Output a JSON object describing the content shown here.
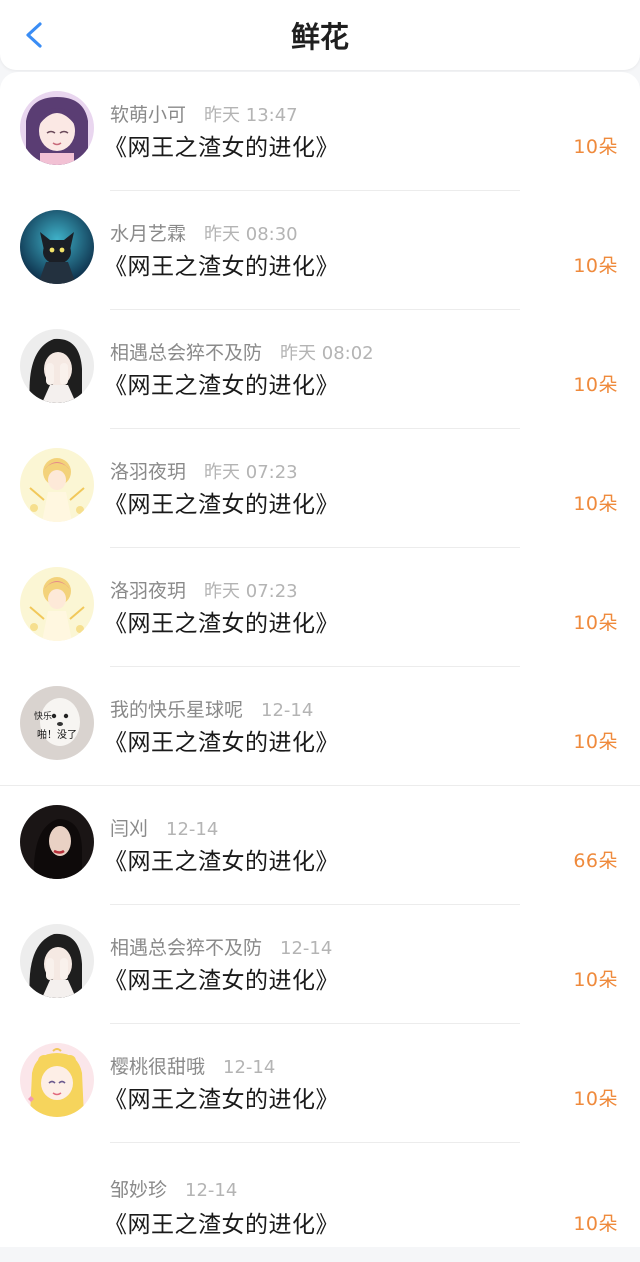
{
  "header": {
    "title": "鲜花",
    "back_icon": "chevron-left-icon",
    "accent": "#3a8df5"
  },
  "colors": {
    "count": "#ef8a3c"
  },
  "items": [
    {
      "user": "软萌小可",
      "time": "昨天 13:47",
      "book": "《网王之渣女的进化》",
      "count": "10朵",
      "avatar": "anime-girl-purple-avatar"
    },
    {
      "user": "水月艺霖",
      "time": "昨天 08:30",
      "book": "《网王之渣女的进化》",
      "count": "10朵",
      "avatar": "dark-knight-avatar"
    },
    {
      "user": "相遇总会猝不及防",
      "time": "昨天 08:02",
      "book": "《网王之渣女的进化》",
      "count": "10朵",
      "avatar": "girl-covering-face-avatar"
    },
    {
      "user": "洛羽夜玥",
      "time": "昨天 07:23",
      "book": "《网王之渣女的进化》",
      "count": "10朵",
      "avatar": "cardcaptor-avatar"
    },
    {
      "user": "洛羽夜玥",
      "time": "昨天 07:23",
      "book": "《网王之渣女的进化》",
      "count": "10朵",
      "avatar": "cardcaptor-avatar"
    },
    {
      "user": "我的快乐星球呢",
      "time": "12-14",
      "book": "《网王之渣女的进化》",
      "count": "10朵",
      "avatar": "white-dog-meme-avatar",
      "avatar_text": [
        "快乐",
        "啪！没了"
      ]
    },
    {
      "user": "闫刈",
      "time": "12-14",
      "book": "《网王之渣女的进化》",
      "count": "66朵",
      "avatar": "dark-portrait-avatar"
    },
    {
      "user": "相遇总会猝不及防",
      "time": "12-14",
      "book": "《网王之渣女的进化》",
      "count": "10朵",
      "avatar": "girl-covering-face-avatar"
    },
    {
      "user": "樱桃很甜哦",
      "time": "12-14",
      "book": "《网王之渣女的进化》",
      "count": "10朵",
      "avatar": "sailor-moon-avatar"
    },
    {
      "user": "邹妙珍",
      "time": "12-14",
      "book": "《网王之渣女的进化》",
      "count": "10朵",
      "avatar": "none"
    }
  ]
}
